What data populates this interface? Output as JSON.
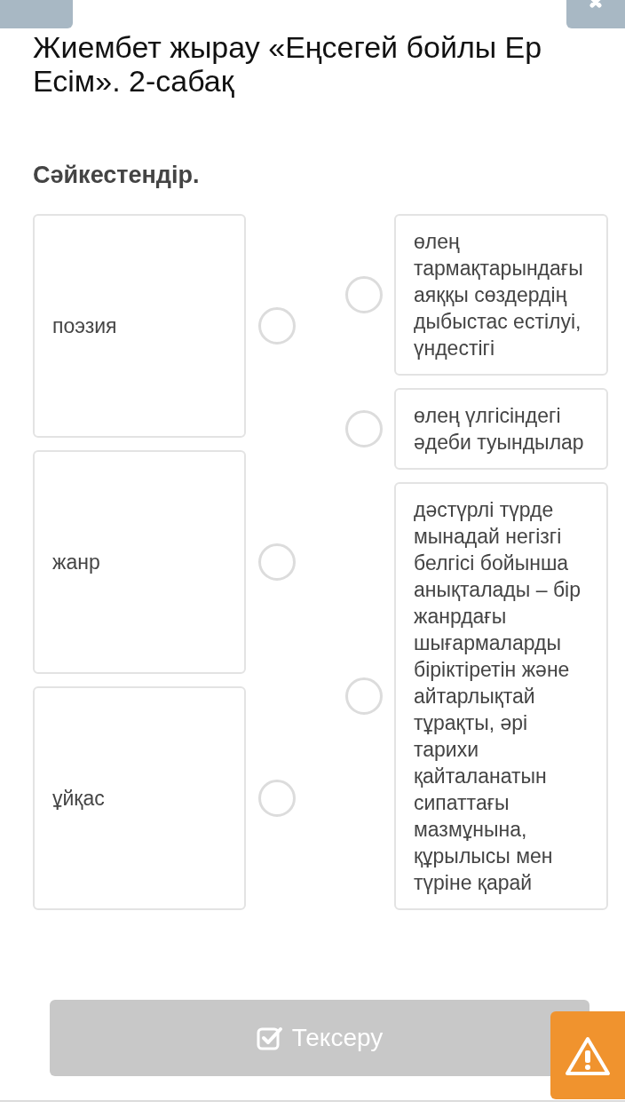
{
  "title": "Жиембет жырау «Еңсегей бойлы Ер Есім». 2-сабақ",
  "instruction": "Сәйкестендір.",
  "left_items": [
    {
      "label": "поэзия"
    },
    {
      "label": "жанр"
    },
    {
      "label": "ұйқас"
    }
  ],
  "right_items": [
    {
      "label": "өлең тармақтарындағы аяққы сөздердің дыбыстас естілуі, үндестігі"
    },
    {
      "label": "өлең үлгісіндегі әдеби туындылар"
    },
    {
      "label": "дәстүрлі түрде мынадай негізгі белгісі бойынша анықталады – бір жанрдағы шығармаларды біріктіретін және айтарлықтай тұрақты, әрі тарихи қайталанатын сипаттағы мазмұнына, құрылысы мен түріне қарай"
    }
  ],
  "check_button": {
    "label": "Тексеру",
    "disabled": true
  }
}
